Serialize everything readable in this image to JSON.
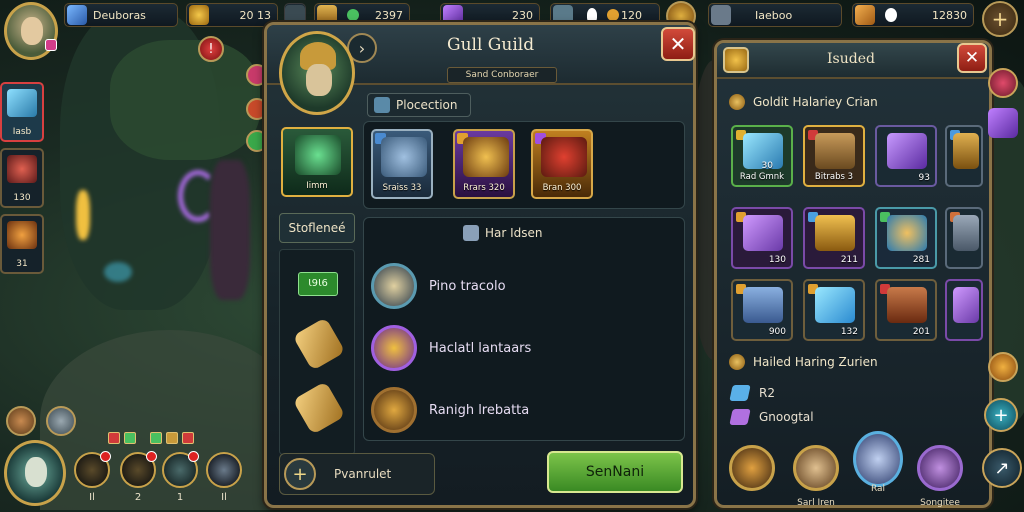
{
  "top_bar": {
    "res1": "Deuboras",
    "res2": "20 13",
    "res3": "2397",
    "res4": "230",
    "res5": "120",
    "res6": "Iaeboo",
    "res7": "12830"
  },
  "left_column": {
    "slot1_label": "Iasb",
    "slot2_label": "130",
    "slot3_label": "31"
  },
  "hero_bar": {
    "skills": [
      "Il",
      "2",
      "1",
      "Il"
    ]
  },
  "guild_panel": {
    "title": "Gull Guild",
    "subtitle": "Sand Conboraer",
    "section_protection": "Plocection",
    "featured_label": "Iimm",
    "cards": [
      "Sraiss 33",
      "Rrars 320",
      "Bran 300"
    ],
    "side_tab": "Stofleneé",
    "green_tag": "Ɩ9Ɩ6",
    "section_hardware": "Har Idsen",
    "list": [
      "Pino tracolo",
      "Haclatl lantaars",
      "Ranigh lrebatta"
    ],
    "footer_input": "Pvanrulet",
    "confirm_label": "SenNani"
  },
  "right_panel": {
    "title": "Isuded",
    "section1": "Goldit Halariey Crian",
    "items_row1": [
      {
        "cap": "Rad Gmnk",
        "cnt": "30"
      },
      {
        "cap": "Bitrabs 3",
        "cnt": ""
      },
      {
        "cap": "",
        "cnt": "93"
      },
      {
        "cap": "",
        "cnt": ""
      }
    ],
    "items_row2": [
      "130",
      "211",
      "281",
      ""
    ],
    "items_row3": [
      "900",
      "132",
      "201",
      ""
    ],
    "section2": "Hailed Haring Zurien",
    "line1": "R2",
    "line2": "Gnoogtal",
    "heroes": [
      "",
      "Sarl Iren",
      "Ral",
      "Songitee"
    ]
  }
}
